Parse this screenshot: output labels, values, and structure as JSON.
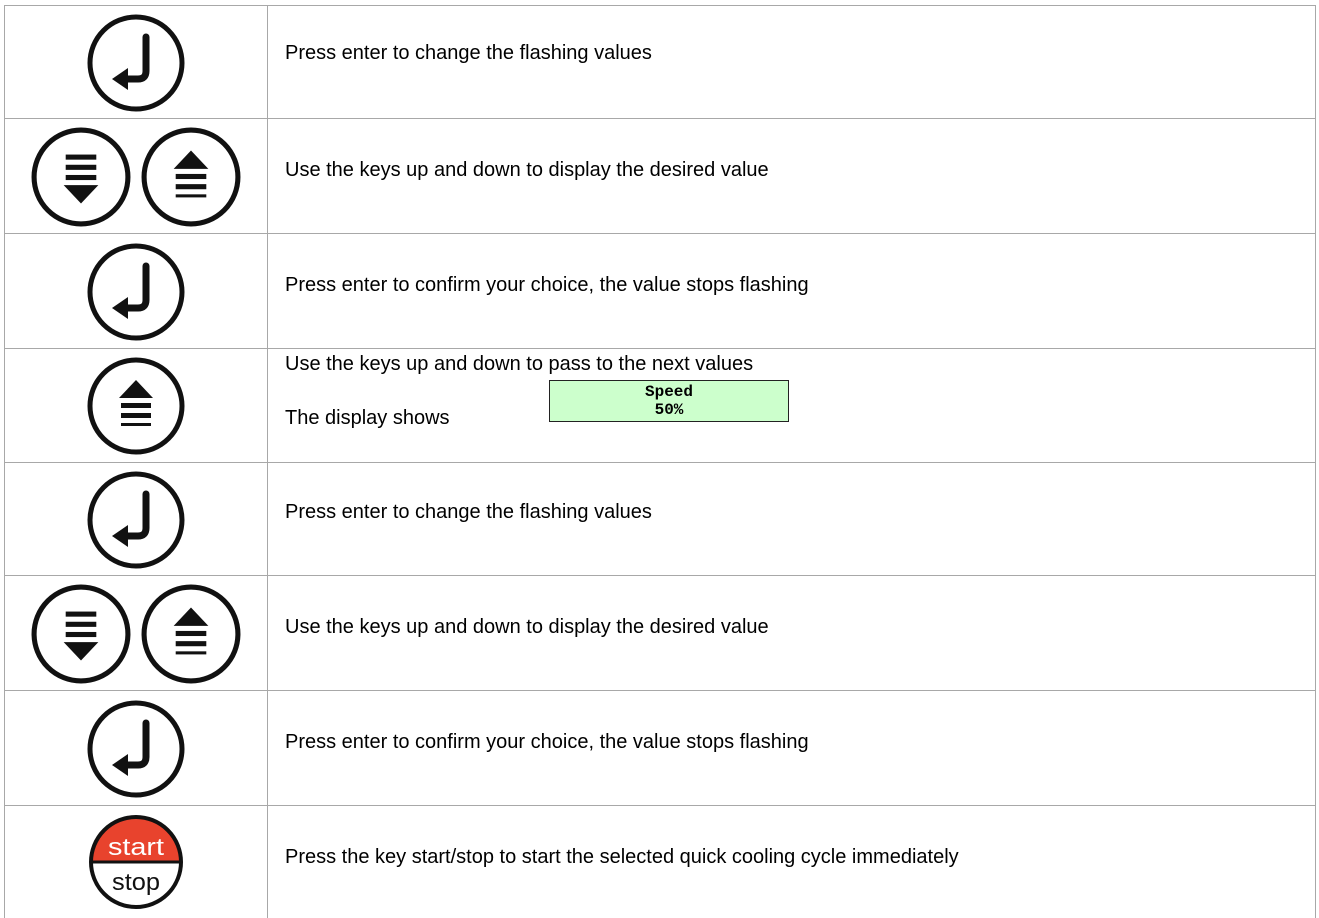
{
  "steps": [
    {
      "keys": [
        "enter-icon"
      ],
      "text": "Press enter to change the flashing values"
    },
    {
      "keys": [
        "down-key-icon",
        "up-key-icon"
      ],
      "text": "Use the keys up and down to display the desired value"
    },
    {
      "keys": [
        "enter-icon"
      ],
      "text": "Press enter to confirm your choice, the value stops flashing"
    },
    {
      "keys": [
        "up-key-icon"
      ],
      "text": "Use the keys up and down to pass to the next values",
      "text2": "The display shows",
      "display_line1": "Speed",
      "display_line2": "50%"
    },
    {
      "keys": [
        "enter-icon"
      ],
      "text": "Press enter to change the flashing values"
    },
    {
      "keys": [
        "down-key-icon",
        "up-key-icon"
      ],
      "text": "Use the keys up and down to display the desired value"
    },
    {
      "keys": [
        "enter-icon"
      ],
      "text": "Press enter to confirm your choice, the value stops flashing"
    },
    {
      "keys": [
        "start-stop-key"
      ],
      "key_top": "start",
      "key_bottom": "stop",
      "text": "Press the key start/stop to start the selected quick cooling cycle immediately"
    }
  ],
  "colors": {
    "start_key": "#e8432d",
    "lcd_background": "#ccffcc",
    "grid_lines": "#a8a8a8"
  }
}
